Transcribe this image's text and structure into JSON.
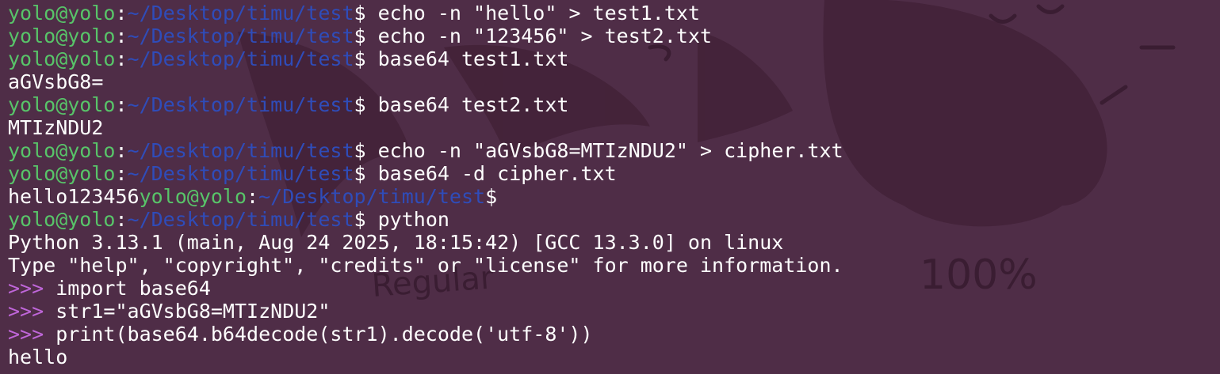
{
  "prompt": {
    "user": "yolo@yolo",
    "sep": ":",
    "path": "~/Desktop/timu/test",
    "sym": "$"
  },
  "lines": [
    {
      "kind": "cmd",
      "text": " echo -n \"hello\" > test1.txt"
    },
    {
      "kind": "cmd",
      "text": " echo -n \"123456\" > test2.txt"
    },
    {
      "kind": "cmd",
      "text": " base64 test1.txt"
    },
    {
      "kind": "out",
      "text": "aGVsbG8="
    },
    {
      "kind": "cmd",
      "text": " base64 test2.txt"
    },
    {
      "kind": "out",
      "text": "MTIzNDU2"
    },
    {
      "kind": "cmd",
      "text": " echo -n \"aGVsbG8=MTIzNDU2\" > cipher.txt"
    },
    {
      "kind": "cmd",
      "text": " base64 -d cipher.txt"
    },
    {
      "kind": "outcmd",
      "pre": "hello123456",
      "text": ""
    },
    {
      "kind": "cmd",
      "text": " python"
    },
    {
      "kind": "out",
      "text": "Python 3.13.1 (main, Aug 24 2025, 18:15:42) [GCC 13.3.0] on linux"
    },
    {
      "kind": "out",
      "text": "Type \"help\", \"copyright\", \"credits\" or \"license\" for more information."
    },
    {
      "kind": "py",
      "text": "import base64"
    },
    {
      "kind": "py",
      "text": "str1=\"aGVsbG8=MTIzNDU2\""
    },
    {
      "kind": "py",
      "text": "print(base64.b64decode(str1).decode('utf-8'))"
    },
    {
      "kind": "out",
      "text": "hello"
    }
  ],
  "py_prompt": ">>> ",
  "wallpaper": {
    "caption_left": "Regular",
    "caption_right": "100%"
  },
  "colors": {
    "background": "#4f2d47",
    "user": "#58c469",
    "path": "#2f4cb9",
    "py_prompt": "#bf66d9"
  }
}
